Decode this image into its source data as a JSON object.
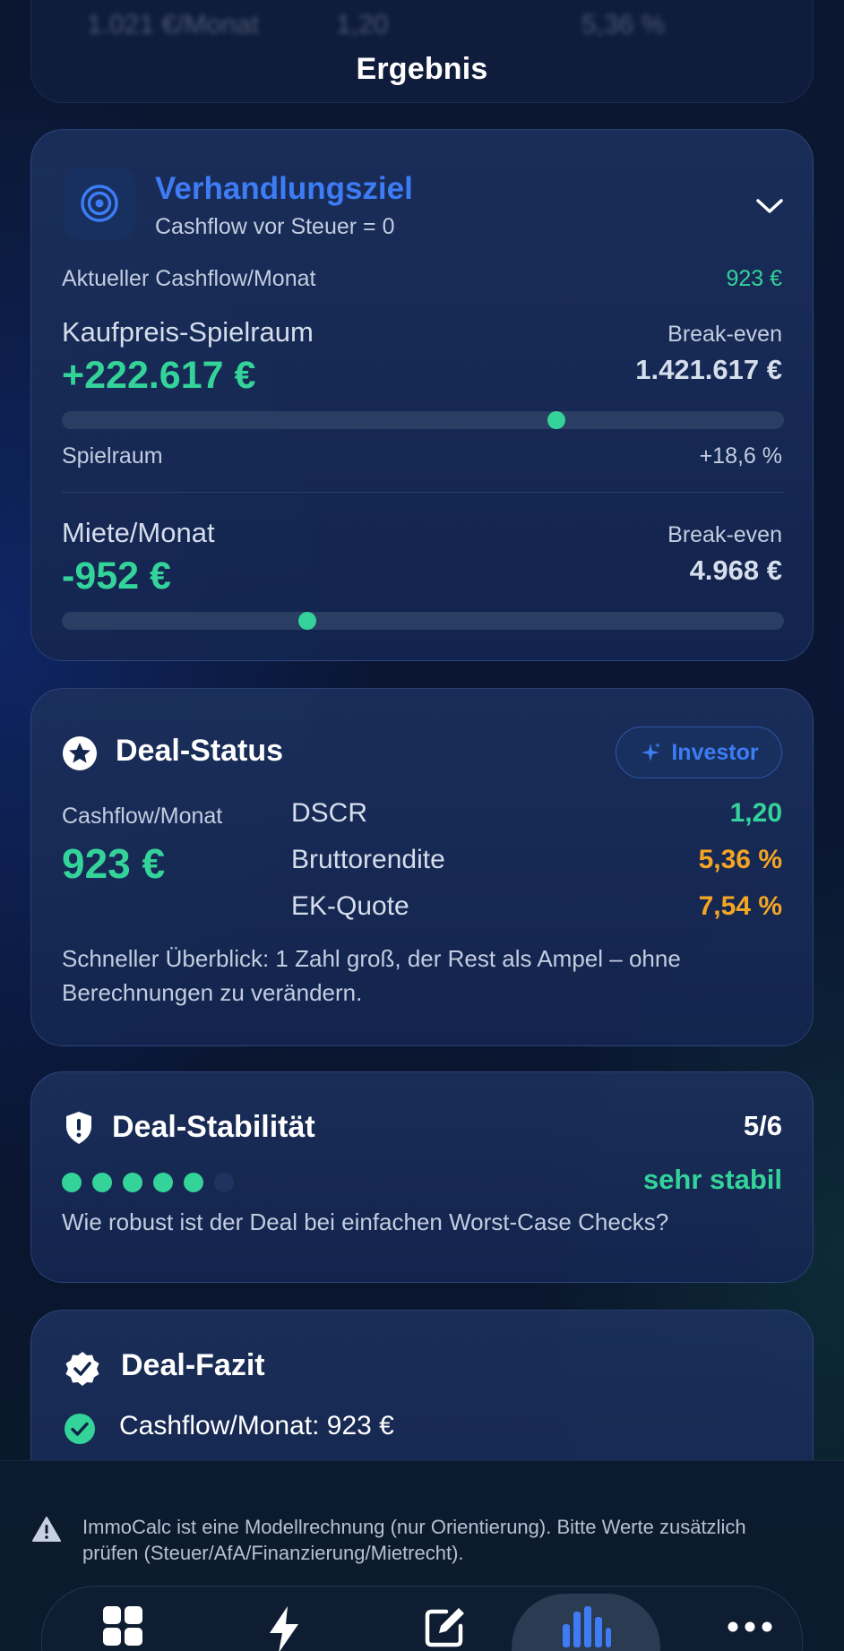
{
  "header": {
    "title": "Ergebnis",
    "ghost_values": [
      "1.021 €/Monat",
      "1,20",
      "5,36 %"
    ]
  },
  "target_card": {
    "title": "Verhandlungsziel",
    "subtitle": "Cashflow vor Steuer = 0",
    "current_label": "Aktueller Cashflow/Monat",
    "current_value": "923 €",
    "price": {
      "label": "Kaufpreis-Spielraum",
      "value": "+222.617 €",
      "breakeven_label": "Break-even",
      "breakeven_value": "1.421.617 €",
      "slider_fraction": 0.685,
      "footer_label": "Spielraum",
      "footer_value": "+18,6 %"
    },
    "rent": {
      "label": "Miete/Monat",
      "value": "-952 €",
      "breakeven_label": "Break-even",
      "breakeven_value": "4.968 €",
      "slider_fraction": 0.34
    }
  },
  "status_card": {
    "title": "Deal-Status",
    "badge": "Investor",
    "cashflow_label": "Cashflow/Monat",
    "cashflow_value": "923 €",
    "metrics": [
      {
        "name": "DSCR",
        "value": "1,20",
        "color": "#34d399"
      },
      {
        "name": "Bruttorendite",
        "value": "5,36 %",
        "color": "#f5a524"
      },
      {
        "name": "EK-Quote",
        "value": "7,54 %",
        "color": "#f5a524"
      }
    ],
    "note": "Schneller Überblick: 1 Zahl groß, der Rest als Ampel – ohne Berechnungen zu verändern."
  },
  "stability_card": {
    "title": "Deal-Stabilität",
    "score": "5/6",
    "filled": 5,
    "total": 6,
    "verdict": "sehr stabil",
    "question": "Wie robust ist der Deal bei einfachen Worst-Case Checks?"
  },
  "fazit_card": {
    "title": "Deal-Fazit",
    "items": [
      "Cashflow/Monat: 923 €"
    ]
  },
  "disclaimer": "ImmoCalc ist eine Modellrechnung (nur Orientierung). Bitte Werte zusätzlich prüfen (Steuer/AfA/Finanzierung/Mietrecht).",
  "tabs": [
    {
      "icon": "grid-icon",
      "active": false
    },
    {
      "icon": "bolt-icon",
      "active": false
    },
    {
      "icon": "edit-icon",
      "active": false
    },
    {
      "icon": "bar-chart-icon",
      "active": true
    },
    {
      "icon": "more-icon",
      "active": false
    }
  ],
  "colors": {
    "accent_blue": "#3d7cf4",
    "green": "#34d399",
    "orange": "#f5a524"
  }
}
